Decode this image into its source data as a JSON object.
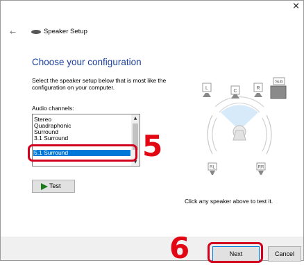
{
  "window": {
    "title": "Speaker Setup",
    "close_glyph": "✕",
    "back_glyph": "←"
  },
  "main": {
    "heading": "Choose your configuration",
    "description": "Select the speaker setup below that is most like the configuration on your computer.",
    "channels_label": "Audio channels:",
    "channels": [
      "Stereo",
      "Quadraphonic",
      "Surround",
      "3.1 Surround",
      "5.1 Surround"
    ],
    "selected_channel": "5.1 Surround",
    "test_button": "Test",
    "hint": "Click any speaker above to test it."
  },
  "speakers": {
    "front_left": "L",
    "center": "C",
    "front_right": "R",
    "subwoofer": "Sub",
    "rear_left": "RL",
    "rear_right": "RR"
  },
  "footer": {
    "next_button": "Next",
    "cancel_button": "Cancel"
  },
  "annotations": {
    "step5": "5",
    "step6": "6"
  },
  "colors": {
    "heading": "#1c3fa0",
    "selection": "#0078d7",
    "highlight": "#d1001f",
    "step_number": "#e30613"
  }
}
